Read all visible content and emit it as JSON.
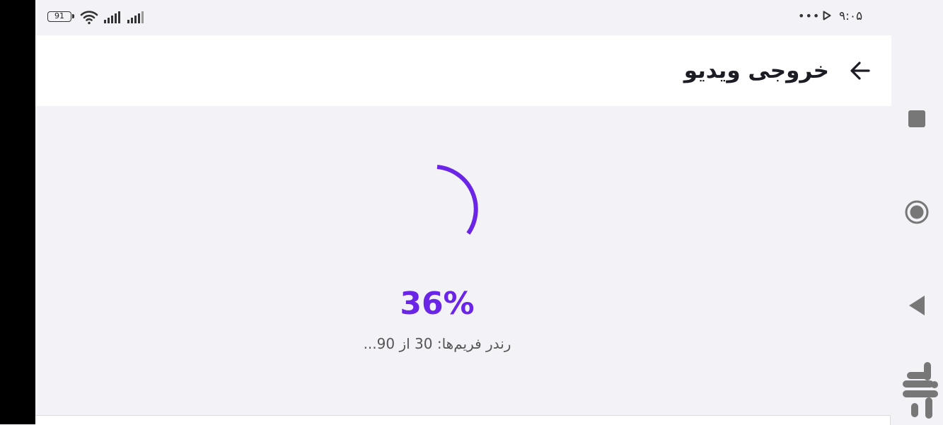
{
  "status_bar": {
    "battery_level": "91",
    "clock": "۹:۰۵",
    "overflow_dots": "•••",
    "icons": [
      "battery-icon",
      "wifi-icon",
      "cell-signal-icon",
      "cell-signal-icon",
      "more-dots-icon",
      "play-icon"
    ]
  },
  "app_bar": {
    "title": "خروجی ویدیو",
    "back_icon": "arrow-back-icon"
  },
  "progress": {
    "percent_label": "36%",
    "percent_value": 0.36,
    "status_text": "رندر فریم‌ها: 30 از 90...",
    "accent_color": "#6a25e6"
  },
  "system_nav": {
    "buttons": [
      "recents-square-icon",
      "home-circle-icon",
      "back-triangle-icon"
    ],
    "logo_icon": "market-logo-icon",
    "icon_color": "#777777"
  }
}
